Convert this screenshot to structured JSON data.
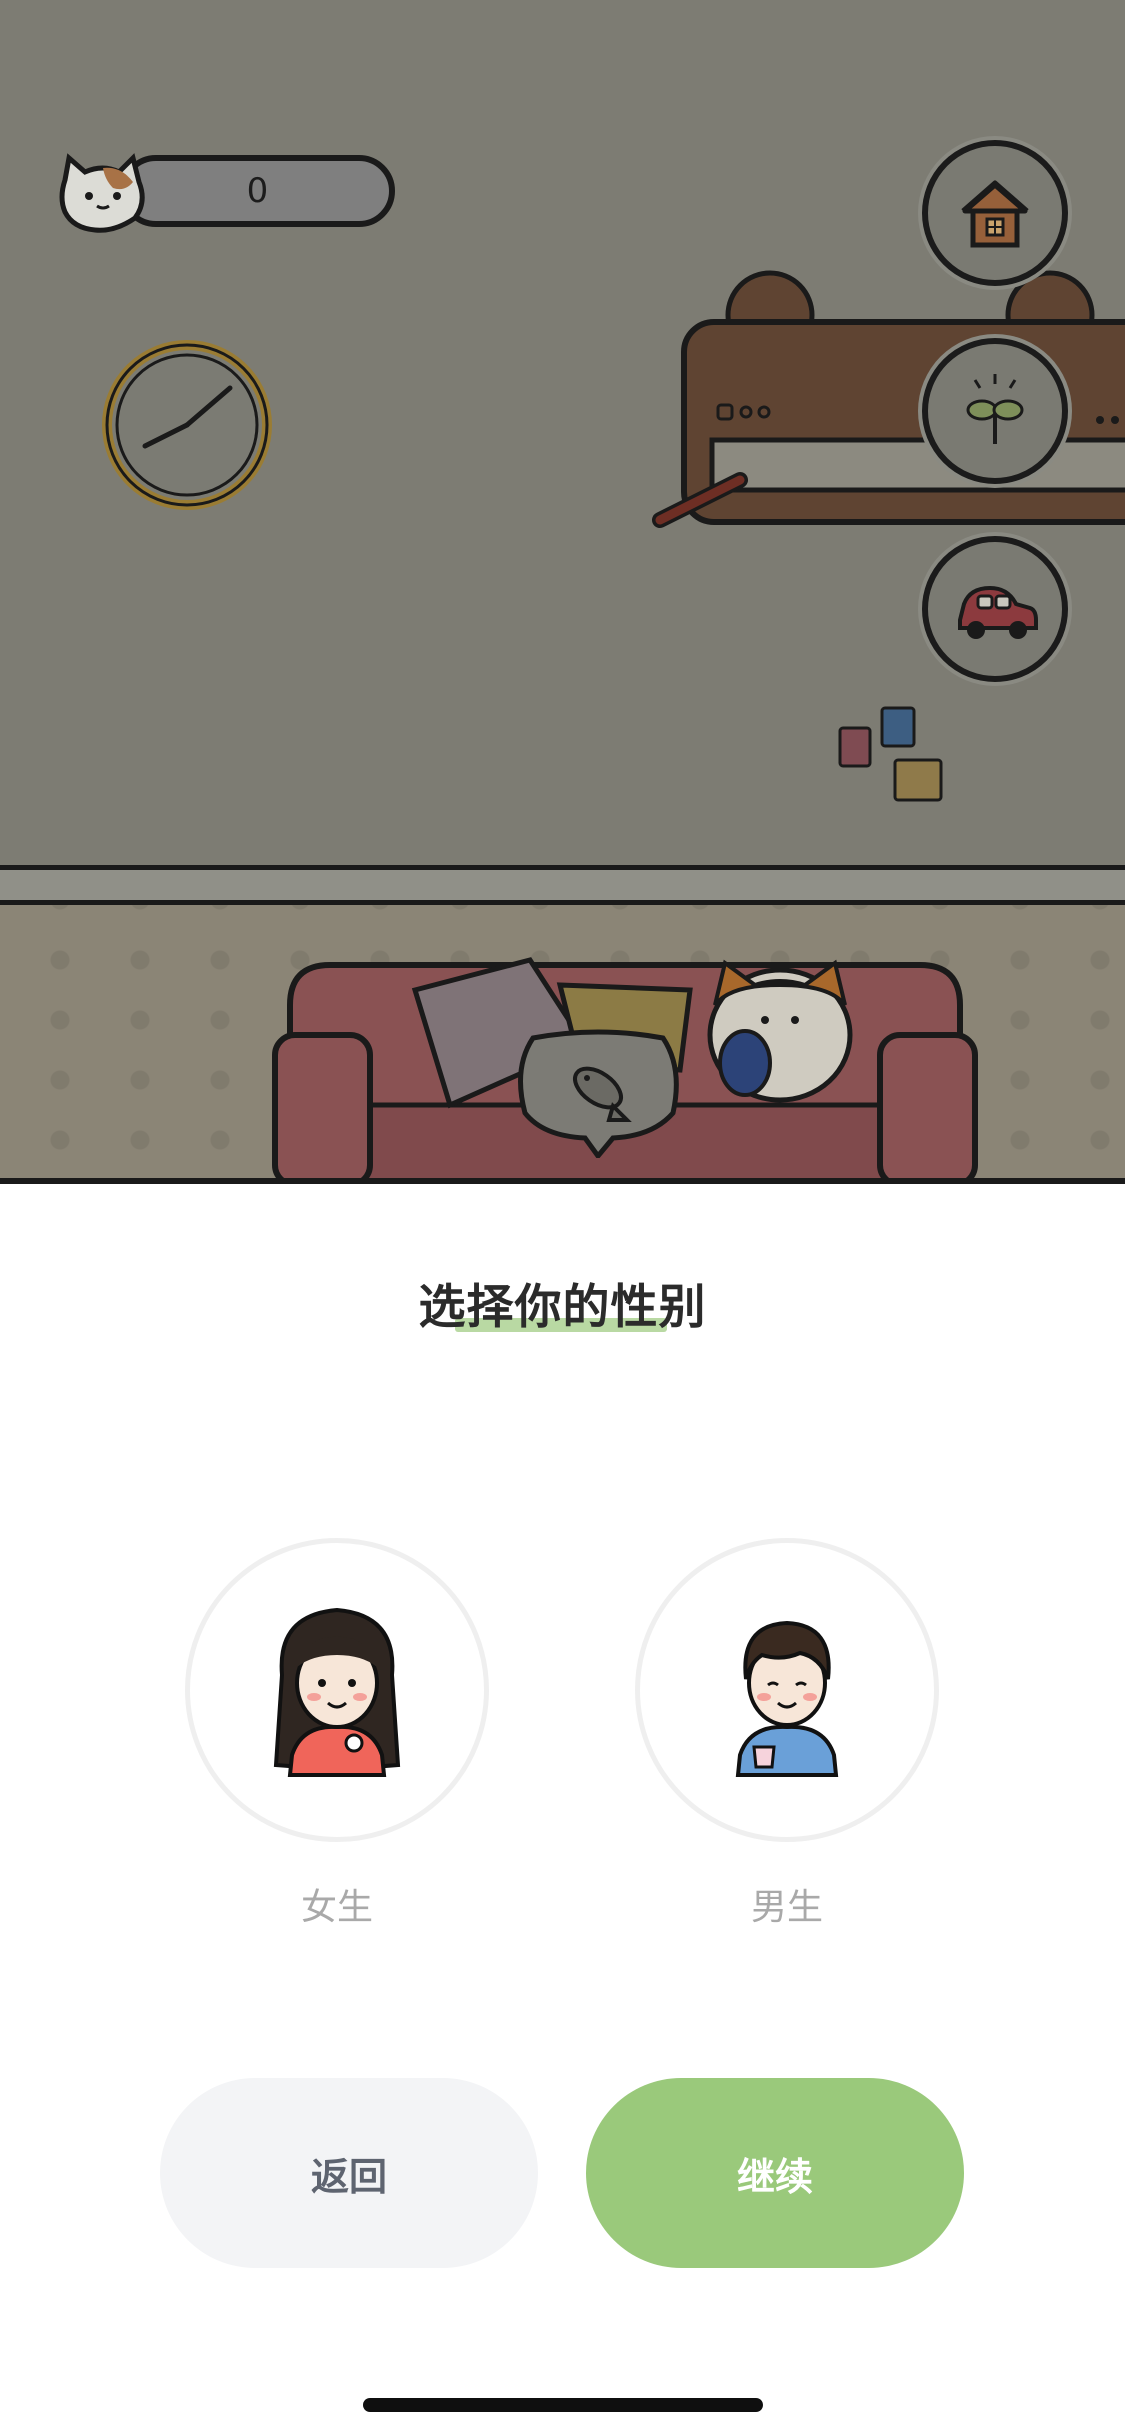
{
  "scene": {
    "coin_count": "0",
    "side_buttons": [
      {
        "icon": "house-icon"
      },
      {
        "icon": "sprout-icon"
      },
      {
        "icon": "car-icon"
      }
    ],
    "bubble_icon": "fish-icon"
  },
  "dialog": {
    "title": "选择你的性别",
    "options": [
      {
        "label": "女生",
        "icon": "girl-avatar-icon"
      },
      {
        "label": "男生",
        "icon": "boy-avatar-icon"
      }
    ],
    "back_label": "返回",
    "continue_label": "继续"
  },
  "colors": {
    "accent_green": "#9ac97b",
    "underline_green": "#b9d9a3",
    "back_button_bg": "#f3f4f6"
  }
}
